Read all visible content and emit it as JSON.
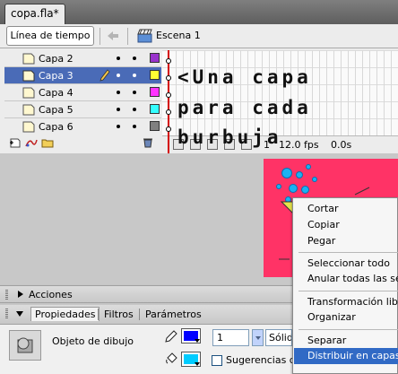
{
  "document_tab": {
    "title": "copa.fla*"
  },
  "toolbar": {
    "timeline_button": "Línea de tiempo",
    "back_icon": "back-arrow-icon",
    "scene_icon": "scene-clapperboard-icon",
    "scene_label": "Escena 1"
  },
  "layers": [
    {
      "name": "Capa 2",
      "color": "#9933cc",
      "selected": false
    },
    {
      "name": "Capa 3",
      "color": "#ffff33",
      "selected": true
    },
    {
      "name": "Capa 4",
      "color": "#ff33ff",
      "selected": false
    },
    {
      "name": "Capa 5",
      "color": "#33ffff",
      "selected": false
    },
    {
      "name": "Capa 6",
      "color": "#808080",
      "selected": false
    }
  ],
  "annotation": {
    "line1": "<Una capa",
    "line2": "para cada",
    "line3": "burbuja"
  },
  "frame_status": {
    "current_frame": "1",
    "fps": "12.0 fps",
    "time": "0.0s"
  },
  "panels": {
    "actions": "Acciones",
    "tabs": [
      "Propiedades",
      "Filtros",
      "Parámetros"
    ],
    "object_label": "Objeto de dibujo",
    "stroke_height": "1",
    "stroke_style": "Sólido",
    "hinting_label": "Sugerencias de",
    "stroke_color": "#0000ff",
    "fill_color": "#00ccff"
  },
  "context_menu": {
    "items": [
      {
        "label": "Cortar"
      },
      {
        "label": "Copiar"
      },
      {
        "label": "Pegar"
      },
      {
        "label": "Seleccionar todo"
      },
      {
        "label": "Anular todas las selecciones"
      },
      {
        "label": "Transformación libre"
      },
      {
        "label": "Organizar"
      },
      {
        "label": "Separar"
      },
      {
        "label": "Distribuir en capas",
        "highlighted": true
      }
    ]
  },
  "stage": {
    "background": "#ff3366",
    "bubble_color": "#1ab2f2"
  }
}
